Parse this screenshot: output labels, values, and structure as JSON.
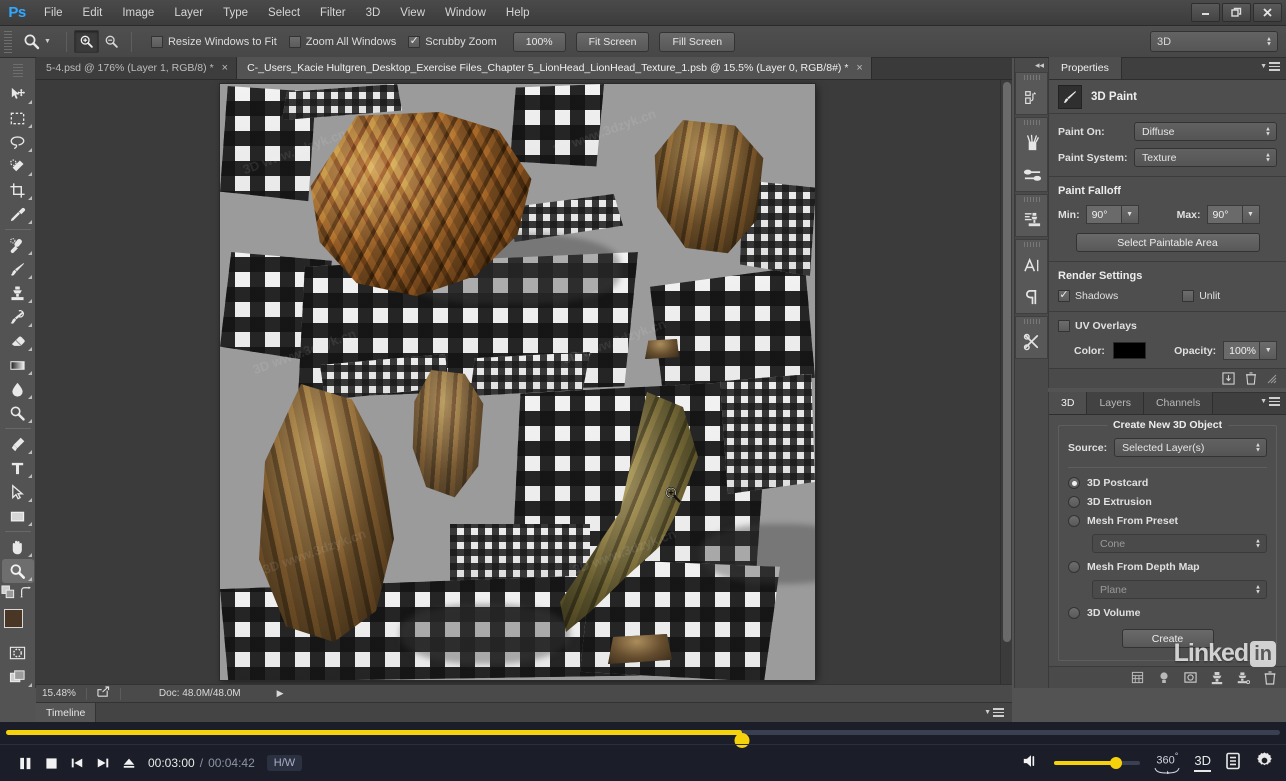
{
  "app": {
    "name": "Ps",
    "logo_text": "Ps",
    "menus": [
      "File",
      "Edit",
      "Image",
      "Layer",
      "Type",
      "Select",
      "Filter",
      "3D",
      "View",
      "Window",
      "Help"
    ],
    "window_buttons": [
      "minimize",
      "restore",
      "close"
    ]
  },
  "options_bar": {
    "tool_icon": "zoom-icon",
    "zoom_in_label": "zoom-in",
    "zoom_out_label": "zoom-out",
    "checkboxes": [
      {
        "label": "Resize Windows to Fit",
        "checked": false
      },
      {
        "label": "Zoom All Windows",
        "checked": false
      },
      {
        "label": "Scrubby Zoom",
        "checked": true
      }
    ],
    "buttons": [
      "100%",
      "Fit Screen",
      "Fill Screen"
    ],
    "workspace": "3D"
  },
  "tabs": [
    {
      "label": "5-4.psd @ 176% (Layer 1, RGB/8) *",
      "active": false,
      "close": "×"
    },
    {
      "label": "C-_Users_Kacie Hultgren_Desktop_Exercise Files_Chapter 5_LionHead_LionHead_Texture_1.psb @ 15.5% (Layer 0, RGB/8#) *",
      "active": true,
      "close": "×"
    }
  ],
  "toolbar": {
    "tools": [
      {
        "name": "move-tool",
        "glyph": "move"
      },
      {
        "name": "marquee-tool",
        "glyph": "marquee"
      },
      {
        "name": "lasso-tool",
        "glyph": "lasso"
      },
      {
        "name": "quick-selection-tool",
        "glyph": "quickselect"
      },
      {
        "name": "crop-tool",
        "glyph": "crop"
      },
      {
        "name": "eyedropper-tool",
        "glyph": "eyedropper"
      },
      {
        "name": "spot-healing-brush-tool",
        "glyph": "healing"
      },
      {
        "name": "brush-tool",
        "glyph": "brush"
      },
      {
        "name": "clone-stamp-tool",
        "glyph": "stamp"
      },
      {
        "name": "history-brush-tool",
        "glyph": "historybrush"
      },
      {
        "name": "eraser-tool",
        "glyph": "eraser"
      },
      {
        "name": "gradient-tool",
        "glyph": "gradient"
      },
      {
        "name": "blur-tool",
        "glyph": "blur"
      },
      {
        "name": "dodge-tool",
        "glyph": "dodge"
      },
      {
        "name": "pen-tool",
        "glyph": "pen"
      },
      {
        "name": "type-tool",
        "glyph": "type"
      },
      {
        "name": "path-selection-tool",
        "glyph": "pathselect"
      },
      {
        "name": "rectangle-tool",
        "glyph": "rectangle"
      },
      {
        "name": "hand-tool",
        "glyph": "hand"
      },
      {
        "name": "zoom-tool",
        "glyph": "zoom",
        "active": true
      }
    ],
    "foreground_color": "#4a3624",
    "background_color": "#ffffff"
  },
  "canvas": {
    "document_description": "UV texture map of photogrammetry-scanned lion head sculpture fragments on black-and-white plaid fabric",
    "background_color": "#9b9b9b",
    "cursor": "zoom-in-cursor"
  },
  "status_bar": {
    "zoom_level": "15.48%",
    "doc_info": "Doc: 48.0M/48.0M",
    "timeline_tab": "Timeline"
  },
  "panels": {
    "properties": {
      "tab_label": "Properties",
      "header_title": "3D Paint",
      "header_icon": "paint-brush-icon",
      "paint_on_label": "Paint On:",
      "paint_on_value": "Diffuse",
      "paint_system_label": "Paint System:",
      "paint_system_value": "Texture",
      "paint_falloff_title": "Paint Falloff",
      "min_label": "Min:",
      "min_value": "90°",
      "max_label": "Max:",
      "max_value": "90°",
      "select_paintable_label": "Select Paintable Area",
      "render_settings_title": "Render Settings",
      "shadows_label": "Shadows",
      "shadows_checked": true,
      "unlit_label": "Unlit",
      "unlit_checked": false,
      "uv_overlays_label": "UV Overlays",
      "uv_overlays_checked": false,
      "color_label": "Color:",
      "color_value": "#000000",
      "opacity_label": "Opacity:",
      "opacity_value": "100%"
    },
    "three_d": {
      "tabs": [
        {
          "label": "3D",
          "active": true
        },
        {
          "label": "Layers",
          "active": false
        },
        {
          "label": "Channels",
          "active": false
        }
      ],
      "group_title": "Create New 3D Object",
      "source_label": "Source:",
      "source_value": "Selected Layer(s)",
      "options": [
        {
          "label": "3D Postcard",
          "selected": true
        },
        {
          "label": "3D Extrusion",
          "selected": false
        },
        {
          "label": "Mesh From Preset",
          "selected": false,
          "sub_value": "Cone"
        },
        {
          "label": "Mesh From Depth Map",
          "selected": false,
          "sub_value": "Plane"
        },
        {
          "label": "3D Volume",
          "selected": false
        }
      ],
      "create_label": "Create",
      "footer_icons": [
        "filter-icon",
        "light-icon",
        "environment-icon",
        "material-icon",
        "mesh-icon",
        "delete-icon"
      ]
    }
  },
  "watermarks": {
    "linkedin_text": "Linked",
    "linkedin_badge": "in",
    "site": "www.3dzyk.cn",
    "brand": "3D"
  },
  "player": {
    "play_state": "pause-icon",
    "current_time": "00:03:00",
    "separator": "/",
    "total_time": "00:04:42",
    "quality_badge": "H/W",
    "progress_percent": 57.8,
    "volume_percent": 72,
    "controls": [
      "pause-button",
      "stop-button",
      "previous-button",
      "next-button",
      "eject-button"
    ],
    "right_controls": [
      "volume-icon",
      "360-button",
      "3d-button",
      "playlist-button",
      "settings-button"
    ],
    "badge_360": "360",
    "badge_360_sup": "°",
    "badge_3d": "3D"
  }
}
